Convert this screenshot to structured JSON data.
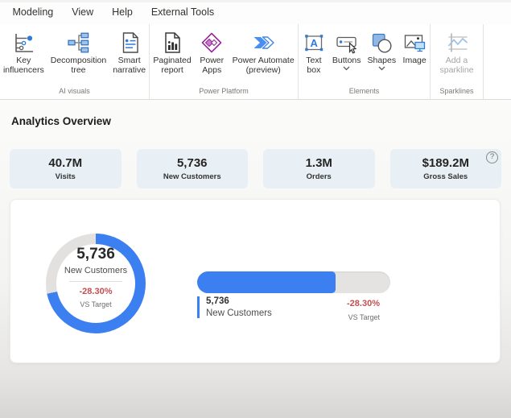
{
  "ribbon": {
    "tabs": [
      "Modeling",
      "View",
      "Help",
      "External Tools"
    ],
    "groups": [
      {
        "label": "AI visuals",
        "items": [
          {
            "label": "Key influencers",
            "icon": "key-influencers-icon"
          },
          {
            "label": "Decomposition tree",
            "icon": "decomposition-tree-icon"
          },
          {
            "label": "Smart narrative",
            "icon": "smart-narrative-icon"
          }
        ]
      },
      {
        "label": "Power Platform",
        "items": [
          {
            "label": "Paginated report",
            "icon": "paginated-report-icon"
          },
          {
            "label": "Power Apps",
            "icon": "power-apps-icon"
          },
          {
            "label": "Power Automate (preview)",
            "icon": "power-automate-icon"
          }
        ]
      },
      {
        "label": "Elements",
        "items": [
          {
            "label": "Text box",
            "icon": "text-box-icon"
          },
          {
            "label": "Buttons",
            "icon": "buttons-icon",
            "dropdown": true
          },
          {
            "label": "Shapes",
            "icon": "shapes-icon",
            "dropdown": true
          },
          {
            "label": "Image",
            "icon": "image-icon"
          }
        ]
      },
      {
        "label": "Sparklines",
        "items": [
          {
            "label": "Add a sparkline",
            "icon": "add-sparkline-icon",
            "disabled": true
          }
        ]
      }
    ]
  },
  "page": {
    "title": "Analytics Overview"
  },
  "kpis": [
    {
      "value": "40.7M",
      "label": "Visits"
    },
    {
      "value": "5,736",
      "label": "New Customers"
    },
    {
      "value": "1.3M",
      "label": "Orders"
    },
    {
      "value": "$189.2M",
      "label": "Gross Sales",
      "help_icon": "?"
    }
  ],
  "colors": {
    "accent_blue": "#3c7ff0",
    "negative_red": "#c24e52",
    "gauge_track": "#e4e3e2",
    "kpi_card_bg": "#e8f0f5"
  },
  "chart_data": [
    {
      "type": "radial-gauge",
      "value": "5,736",
      "label": "New Customers",
      "delta": "-28.30%",
      "delta_label": "VS Target",
      "fill_pct": 71.7,
      "fill_color": "#3c7ff0",
      "track_color": "#e2e1e0"
    },
    {
      "type": "linear-gauge",
      "value": "5,736",
      "label": "New Customers",
      "delta": "-28.30%",
      "delta_label": "VS Target",
      "fill_pct": 71.7,
      "fill_color": "#3c7ff0",
      "track_color": "#e4e3e2"
    }
  ],
  "help": {
    "glyph": "?"
  }
}
